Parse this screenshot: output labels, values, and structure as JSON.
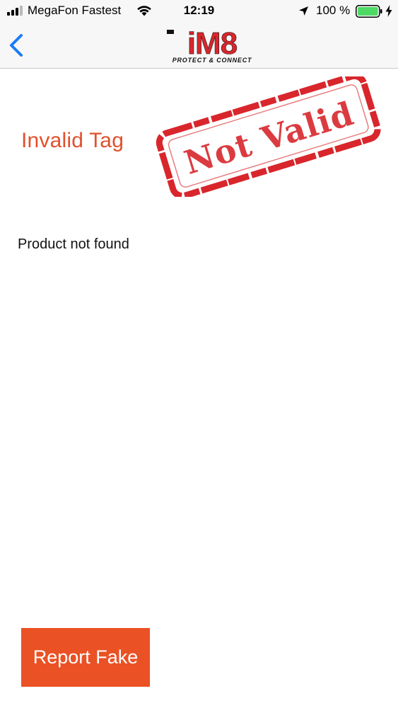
{
  "status_bar": {
    "carrier": "MegaFon Fastest",
    "time": "12:19",
    "battery_percent": "100 %",
    "icons": [
      "cellular-signal-icon",
      "wifi-icon",
      "location-arrow-icon",
      "battery-icon",
      "charging-bolt-icon"
    ]
  },
  "nav": {
    "back_icon": "chevron-left-icon",
    "logo_text": "iM8",
    "logo_tagline": "PROTECT & CONNECT"
  },
  "result": {
    "title": "Invalid Tag",
    "stamp_text": "Not Valid",
    "message": "Product not found"
  },
  "actions": {
    "report_label": "Report Fake"
  },
  "colors": {
    "accent": "#e2502c",
    "button": "#ea5124",
    "stamp": "#d8262c",
    "ios_blue": "#1a7cf5",
    "battery_green": "#4cd964"
  }
}
